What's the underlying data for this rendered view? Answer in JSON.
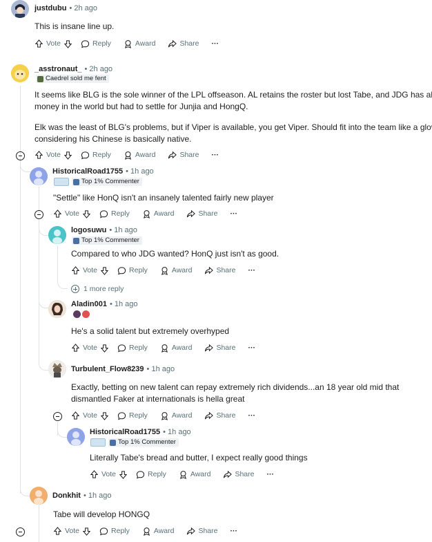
{
  "actions": {
    "vote": "Vote",
    "reply": "Reply",
    "award": "Award",
    "share": "Share",
    "more": "···"
  },
  "comments": [
    {
      "user": "justdubu",
      "time": "2h ago",
      "body": [
        "This is insane line up."
      ]
    },
    {
      "user": "_asstronaut_",
      "time": "2h ago",
      "flair": "Caedrel sold me fent",
      "body": [
        "It seems like BLG is the sole winner of the LPL offseason. AL retains the roster but lost Tabe, and JDG has all the",
        "money in the world but had to settle for Junjia and HongQ.",
        "Elk was the least of BLG's problems, but if Viper is available, you get Viper. Should fit into the team like a glove",
        "considering his Chinese is basically native."
      ]
    },
    {
      "user": "HistoricalRoad1755",
      "time": "1h ago",
      "flair": "Top 1% Commenter",
      "body": [
        "\"Settle\" like HonQ isn't an insanely talented fairly new player"
      ]
    },
    {
      "user": "logosuwu",
      "time": "1h ago",
      "flair": "Top 1% Commenter",
      "body": [
        "Compared to who JDG wanted? HonQ just isn't as good."
      ],
      "more_replies": "1 more reply"
    },
    {
      "user": "Aladin001",
      "time": "1h ago",
      "body": [
        "He's a solid talent but extremely overhyped"
      ]
    },
    {
      "user": "Turbulent_Flow8239",
      "time": "1h ago",
      "body": [
        "Exactly, betting on new talent can repay extremely rich dividends...an 18 year old mid that",
        "dismantled Faker at internationals is hella great"
      ]
    },
    {
      "user": "HistoricalRoad1755",
      "time": "1h ago",
      "flair": "Top 1% Commenter",
      "body": [
        "Literally Tabe's bread and butter, I expect really good things"
      ]
    },
    {
      "user": "Donkhit",
      "time": "1h ago",
      "body": [
        "Tabe will develop HONGQ"
      ]
    }
  ]
}
